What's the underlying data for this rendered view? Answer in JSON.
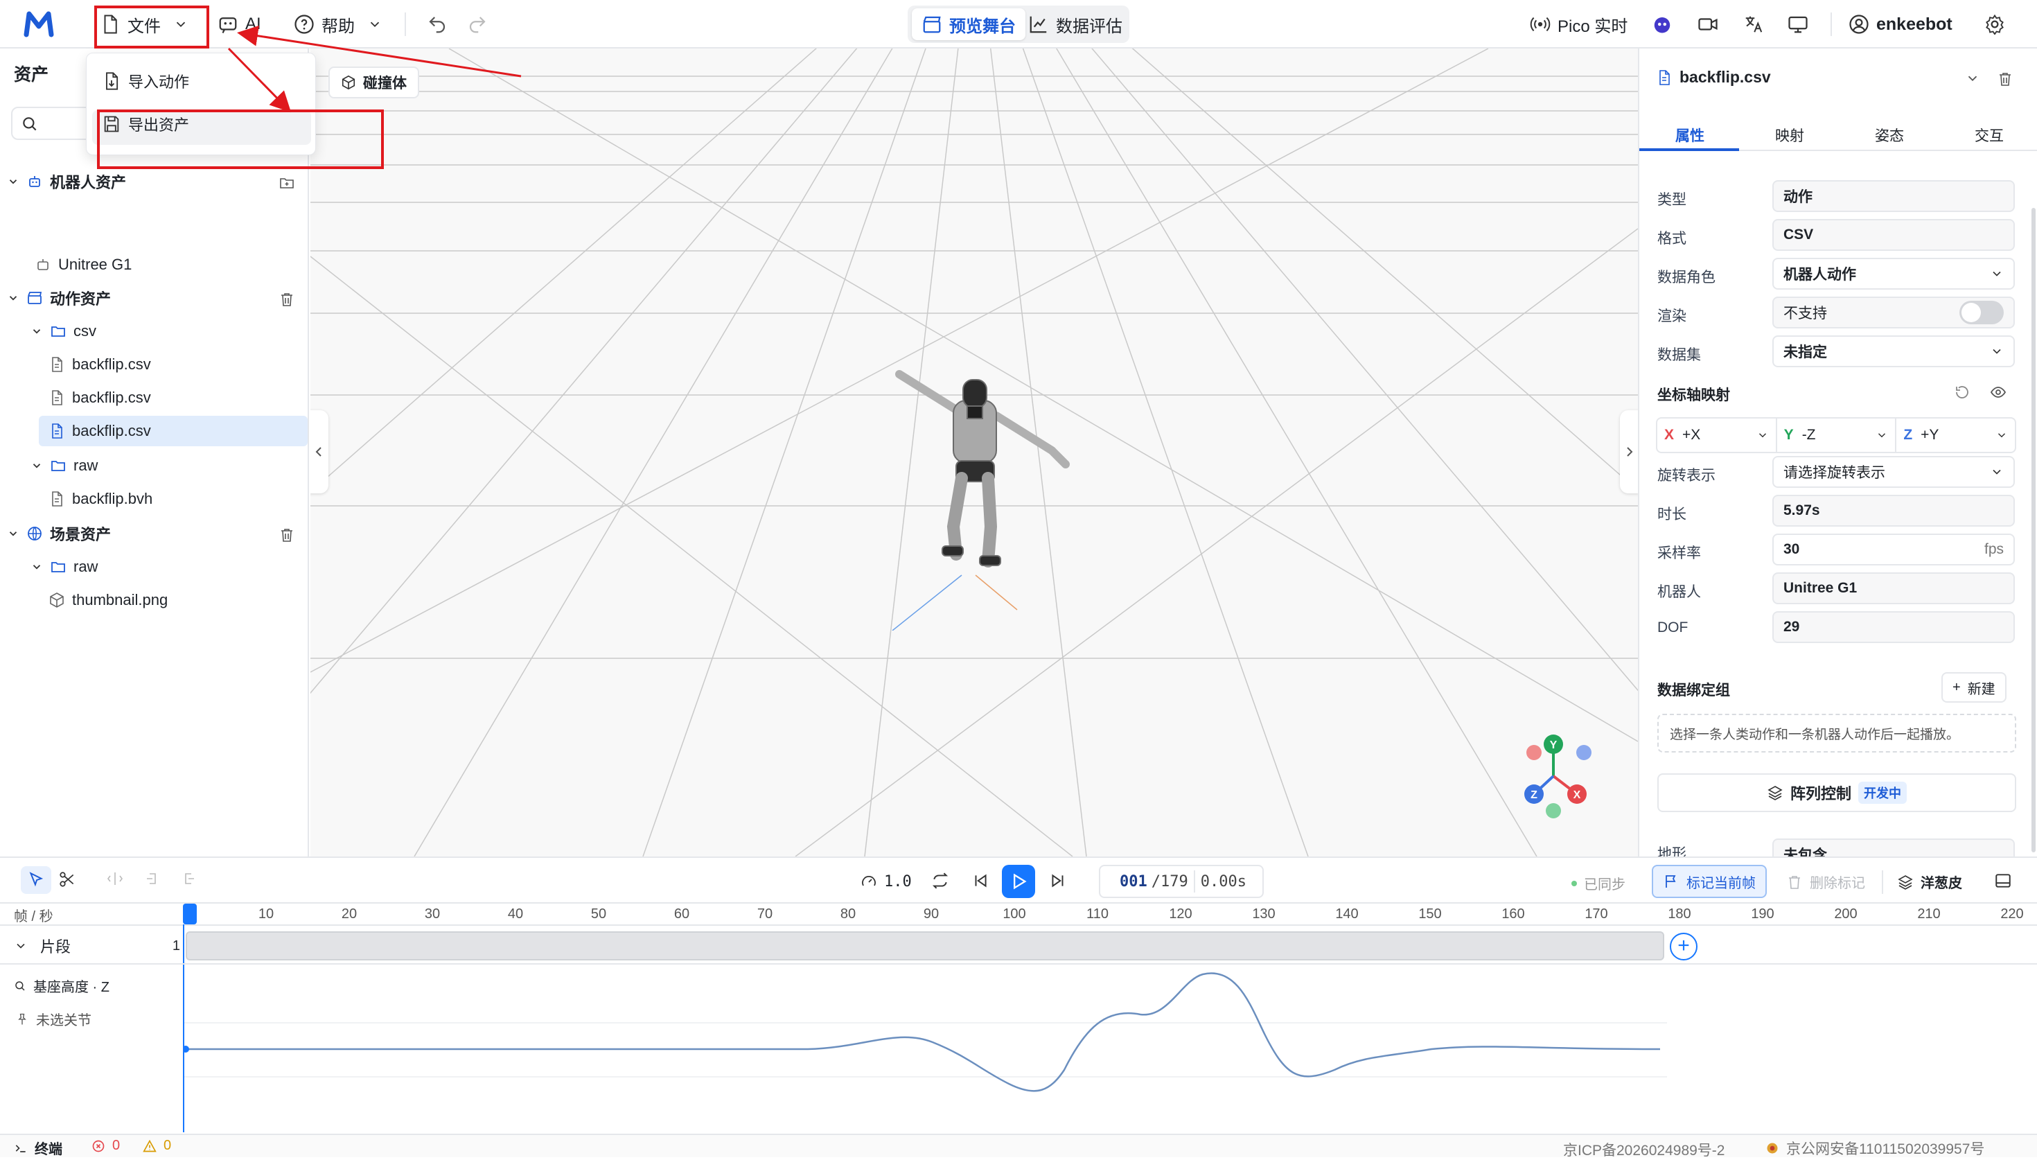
{
  "topbar": {
    "file": "文件",
    "ai": "AI",
    "help": "帮助",
    "preview_stage": "预览舞台",
    "data_eval": "数据评估",
    "pico": "Pico 实时",
    "user": "enkeebot"
  },
  "file_menu": {
    "import_motion": "导入动作",
    "export_assets": "导出资产"
  },
  "collider": "碰撞体",
  "assets": {
    "title": "资产",
    "robot_assets": "机器人资产",
    "robot_item": "Unitree G1",
    "motion_assets": "动作资产",
    "csv_folder": "csv",
    "csv_files": [
      "backflip.csv",
      "backflip.csv",
      "backflip.csv"
    ],
    "raw_folder": "raw",
    "bvh_file": "backflip.bvh",
    "scene_assets": "场景资产",
    "scene_raw": "raw",
    "png_file": "thumbnail.png"
  },
  "props": {
    "file_name": "backflip.csv",
    "tabs": [
      "属性",
      "映射",
      "姿态",
      "交互"
    ],
    "type_label": "类型",
    "type_value": "动作",
    "format_label": "格式",
    "format_value": "CSV",
    "role_label": "数据角色",
    "role_value": "机器人动作",
    "render_label": "渲染",
    "render_value": "不支持",
    "dataset_label": "数据集",
    "dataset_value": "未指定",
    "axis_map_label": "坐标轴映射",
    "axis_x": "X",
    "axis_x_val": "+X",
    "axis_y": "Y",
    "axis_y_val": "-Z",
    "axis_z": "Z",
    "axis_z_val": "+Y",
    "rotation_label": "旋转表示",
    "rotation_value": "请选择旋转表示",
    "duration_label": "时长",
    "duration_value": "5.97s",
    "rate_label": "采样率",
    "rate_value": "30",
    "rate_unit": "fps",
    "robot_label": "机器人",
    "robot_value": "Unitree G1",
    "dof_label": "DOF",
    "dof_value": "29",
    "binding_label": "数据绑定组",
    "new_btn": "新建",
    "binding_hint": "选择一条人类动作和一条机器人动作后一起播放。",
    "array_ctrl": "阵列控制",
    "dev_badge": "开发中",
    "cut_off": "地形",
    "cut_off_value": "未包含"
  },
  "timeline": {
    "speed": "1.0",
    "frame": "001",
    "total": "/179",
    "time": "0.00s",
    "synced": "已同步",
    "mark_frame": "标记当前帧",
    "delete_mark": "删除标记",
    "onion": "洋葱皮",
    "unit": "帧 / 秒",
    "ticks": [
      "10",
      "20",
      "30",
      "40",
      "50",
      "60",
      "70",
      "80",
      "90",
      "100",
      "110",
      "120",
      "130",
      "140",
      "150",
      "160",
      "170",
      "180",
      "190",
      "200",
      "210",
      "220"
    ],
    "segment": "片段",
    "segment_count": "1",
    "base_height": "基座高度 · Z",
    "no_joint": "未选关节"
  },
  "status": {
    "terminal": "终端",
    "errors": "0",
    "warnings": "0",
    "icp": "京ICP备2026024989号-2",
    "police": "京公网安备11011502039957号"
  },
  "colors": {
    "accent": "#1677ff",
    "annotation_red": "#e0191e",
    "axis_x": "#e5484d",
    "axis_y": "#22a55a",
    "axis_z": "#3b73e0"
  }
}
